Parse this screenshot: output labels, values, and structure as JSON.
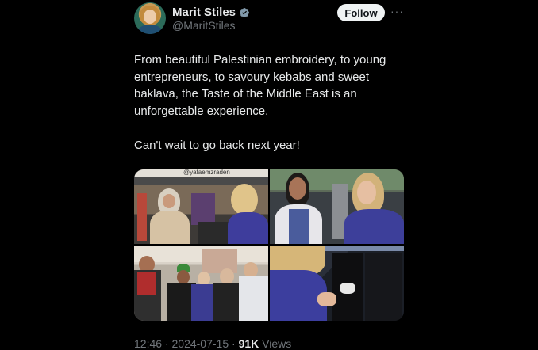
{
  "author": {
    "display_name": "Marit Stiles",
    "handle": "@MaritStiles",
    "verified": true
  },
  "actions": {
    "follow_label": "Follow",
    "more_label": "···"
  },
  "tweet": {
    "paragraphs": [
      "From beautiful Palestinian embroidery, to young entrepreneurs, to savoury kebabs and sweet baklava, the Taste of the Middle East is an unforgettable experience.",
      "Can't wait to go back next year!"
    ]
  },
  "meta": {
    "time": "12:46",
    "separator": "·",
    "date": "2024-07-15",
    "views_count": "91K",
    "views_label": "Views"
  },
  "media": {
    "photo_1_sign": "@yafaemzraden"
  },
  "colors": {
    "background": "#000000",
    "text_primary": "#e7e9ea",
    "text_secondary": "#71767b",
    "verified_badge": "#829aab",
    "follow_bg": "#eff3f4"
  },
  "icons": [
    "verified-badge-icon",
    "more-options-icon"
  ]
}
